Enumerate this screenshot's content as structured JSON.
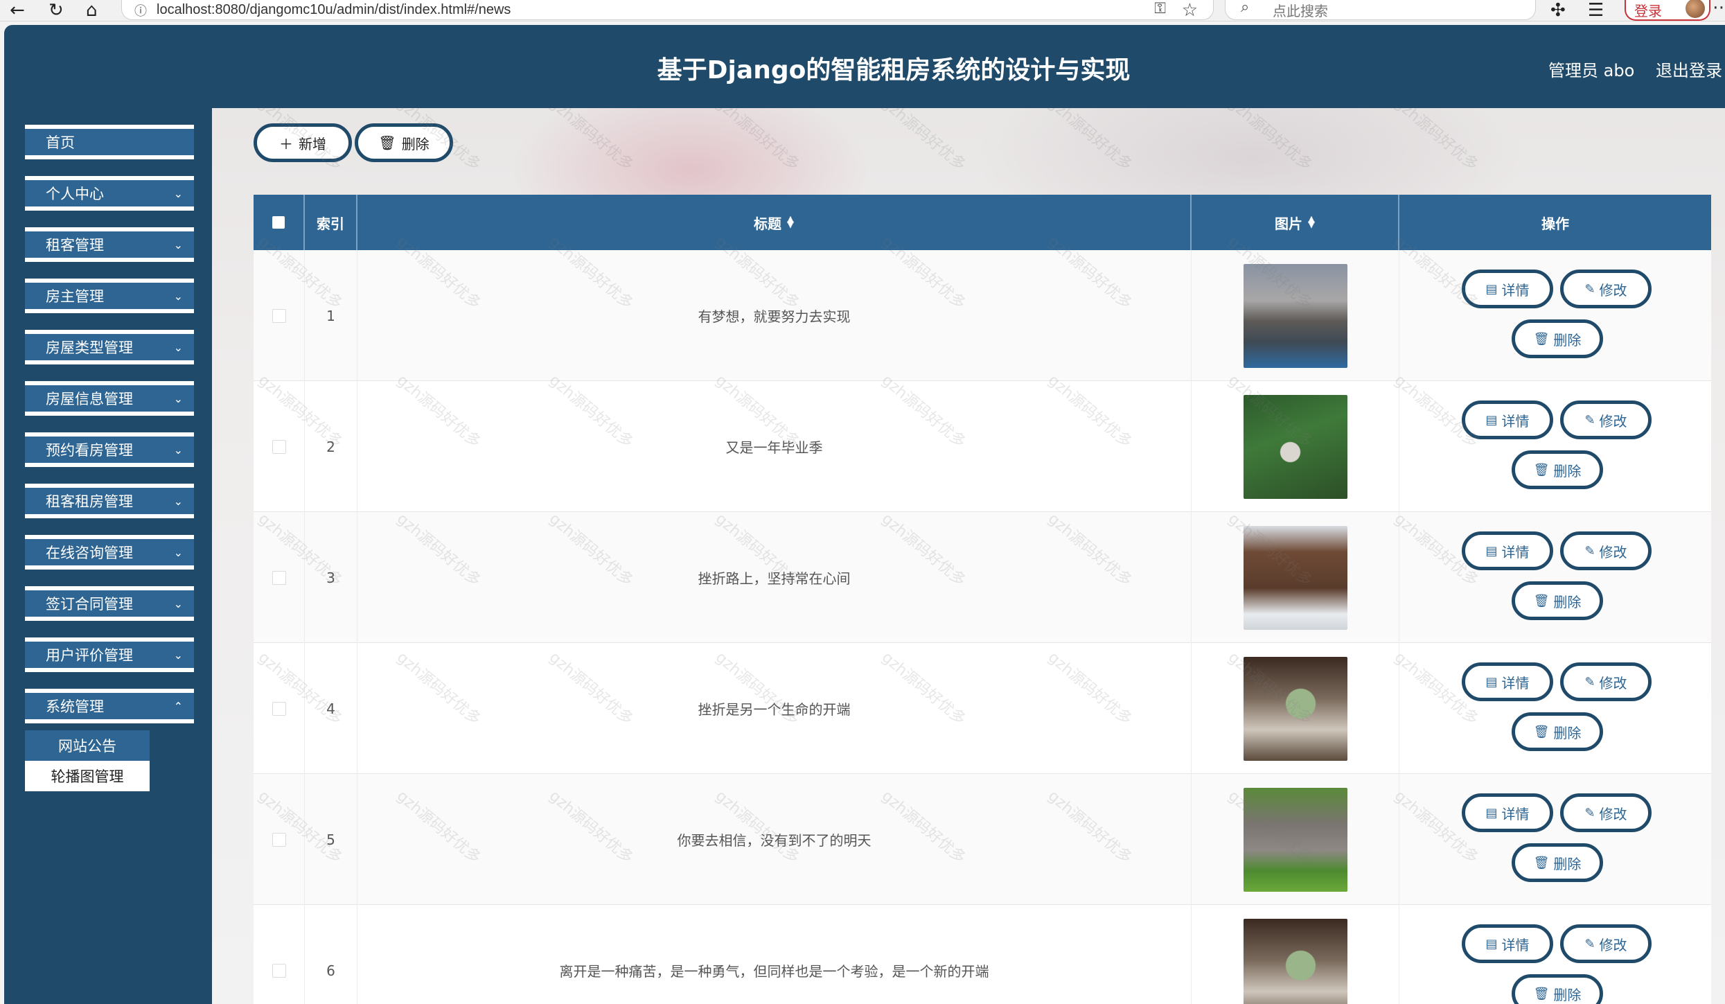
{
  "browser": {
    "url": "localhost:8080/djangomc10u/admin/dist/index.html#/news",
    "search_placeholder": "点此搜索",
    "login_label": "登录"
  },
  "header": {
    "title": "基于Django的智能租房系统的设计与实现",
    "user": "管理员 abo",
    "logout": "退出登录"
  },
  "sidebar": {
    "items": [
      {
        "label": "首页"
      },
      {
        "label": "个人中心"
      },
      {
        "label": "租客管理"
      },
      {
        "label": "房主管理"
      },
      {
        "label": "房屋类型管理"
      },
      {
        "label": "房屋信息管理"
      },
      {
        "label": "预约看房管理"
      },
      {
        "label": "租客租房管理"
      },
      {
        "label": "在线咨询管理"
      },
      {
        "label": "签订合同管理"
      },
      {
        "label": "用户评价管理"
      },
      {
        "label": "系统管理"
      }
    ],
    "sub_items": [
      {
        "label": "网站公告",
        "active": true
      },
      {
        "label": "轮播图管理",
        "active": false
      }
    ]
  },
  "toolbar": {
    "add_label": "新增",
    "delete_label": "删除"
  },
  "table": {
    "headers": {
      "index": "索引",
      "title": "标题",
      "image": "图片",
      "actions": "操作"
    },
    "actions": {
      "detail": "详情",
      "edit": "修改",
      "delete": "删除"
    },
    "rows": [
      {
        "index": "1",
        "title": "有梦想，就要努力去实现",
        "image": "building-dusk"
      },
      {
        "index": "2",
        "title": "又是一年毕业季",
        "image": "villa-forest"
      },
      {
        "index": "3",
        "title": "挫折路上，坚持常在心间",
        "image": "chalet-snow"
      },
      {
        "index": "4",
        "title": "挫折是另一个生命的开端",
        "image": "bedroom-window"
      },
      {
        "index": "5",
        "title": "你要去相信，没有到不了的明天",
        "image": "barn-field"
      },
      {
        "index": "6",
        "title": "离开是一种痛苦，是一种勇气，但同样也是一个考验，是一个新的开端",
        "image": "bedroom-window"
      }
    ]
  },
  "watermark": "gzh源码好优多"
}
